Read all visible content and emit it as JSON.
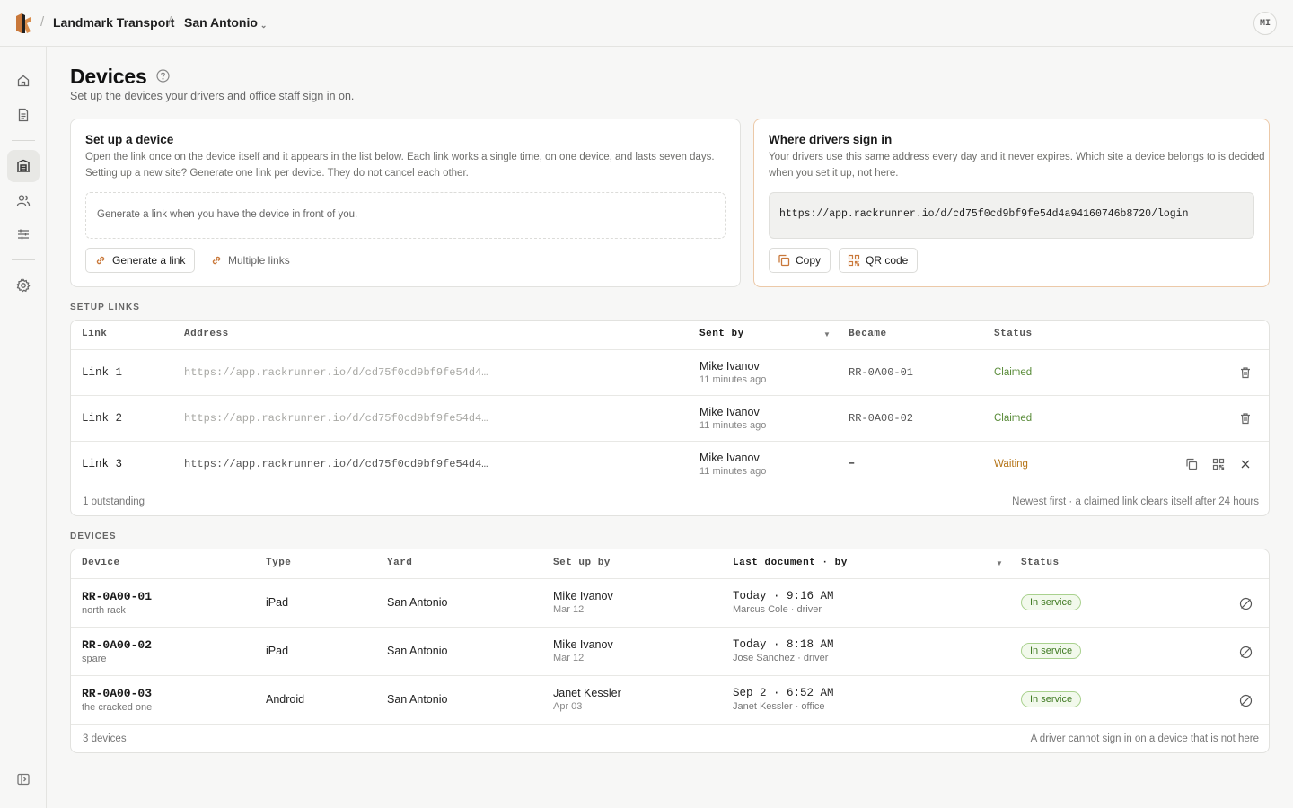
{
  "breadcrumb": {
    "org": "Landmark Transport",
    "site": "San Antonio",
    "separator": "/"
  },
  "user": {
    "initials": "MI"
  },
  "page": {
    "title": "Devices",
    "subtitle": "Set up the devices your drivers and office staff sign in on."
  },
  "setup_card": {
    "title": "Set up a device",
    "description_line1": "Open the link once on the device itself and it appears in the list below. Each link works a single time, on one device, and lasts seven days.",
    "description_line2": "Setting up a new site? Generate one link per device. They do not cancel each other.",
    "placeholder": "Generate a link when you have the device in front of you.",
    "generate_label": "Generate a link",
    "multiple_label": "Multiple links"
  },
  "signin_card": {
    "title": "Where drivers sign in",
    "description_line1": "Your drivers use this same address every day and it never expires. Which site a device belongs to is decided",
    "description_line2": "when you set it up, not here.",
    "url": "https://app.rackrunner.io/d/cd75f0cd9bf9fe54d4a94160746b8720/login",
    "copy_label": "Copy",
    "qr_label": "QR code"
  },
  "setup_links": {
    "section_label": "SETUP LINKS",
    "columns": {
      "link": "Link",
      "address": "Address",
      "sent_by": "Sent by",
      "became": "Became",
      "status": "Status"
    },
    "rows": [
      {
        "link": "Link 1",
        "address": "https://app.rackrunner.io/d/cd75f0cd9bf9fe54d4…",
        "sent_by": "Mike Ivanov",
        "sent_ago": "11 minutes ago",
        "became": "RR-0A00-01",
        "status": "Claimed"
      },
      {
        "link": "Link 2",
        "address": "https://app.rackrunner.io/d/cd75f0cd9bf9fe54d4…",
        "sent_by": "Mike Ivanov",
        "sent_ago": "11 minutes ago",
        "became": "RR-0A00-02",
        "status": "Claimed"
      },
      {
        "link": "Link 3",
        "address": "https://app.rackrunner.io/d/cd75f0cd9bf9fe54d4…",
        "sent_by": "Mike Ivanov",
        "sent_ago": "11 minutes ago",
        "became": "–",
        "status": "Waiting"
      }
    ],
    "footer_left": "1 outstanding",
    "footer_right": "Newest first · a claimed link clears itself after 24 hours"
  },
  "devices": {
    "section_label": "DEVICES",
    "columns": {
      "device": "Device",
      "type": "Type",
      "yard": "Yard",
      "setup_by": "Set up by",
      "last_doc": "Last document · by",
      "status": "Status"
    },
    "rows": [
      {
        "name": "RR-0A00-01",
        "note": "north rack",
        "type": "iPad",
        "yard": "San Antonio",
        "setup_by": "Mike Ivanov",
        "setup_date": "Mar 12",
        "last_doc": "Today · 9:16 AM",
        "last_by": "Marcus Cole · driver",
        "status": "In service"
      },
      {
        "name": "RR-0A00-02",
        "note": "spare",
        "type": "iPad",
        "yard": "San Antonio",
        "setup_by": "Mike Ivanov",
        "setup_date": "Mar 12",
        "last_doc": "Today · 8:18 AM",
        "last_by": "Jose Sanchez · driver",
        "status": "In service"
      },
      {
        "name": "RR-0A00-03",
        "note": "the cracked one",
        "type": "Android",
        "yard": "San Antonio",
        "setup_by": "Janet Kessler",
        "setup_date": "Apr 03",
        "last_doc": "Sep 2 · 6:52 AM",
        "last_by": "Janet Kessler · office",
        "status": "In service"
      }
    ],
    "footer_left": "3 devices",
    "footer_right": "A driver cannot sign in on a device that is not here"
  },
  "colors": {
    "accent": "#c9783a",
    "claimed": "#5a8c3a",
    "waiting": "#b57417",
    "badge_green": "#3f7a22"
  }
}
